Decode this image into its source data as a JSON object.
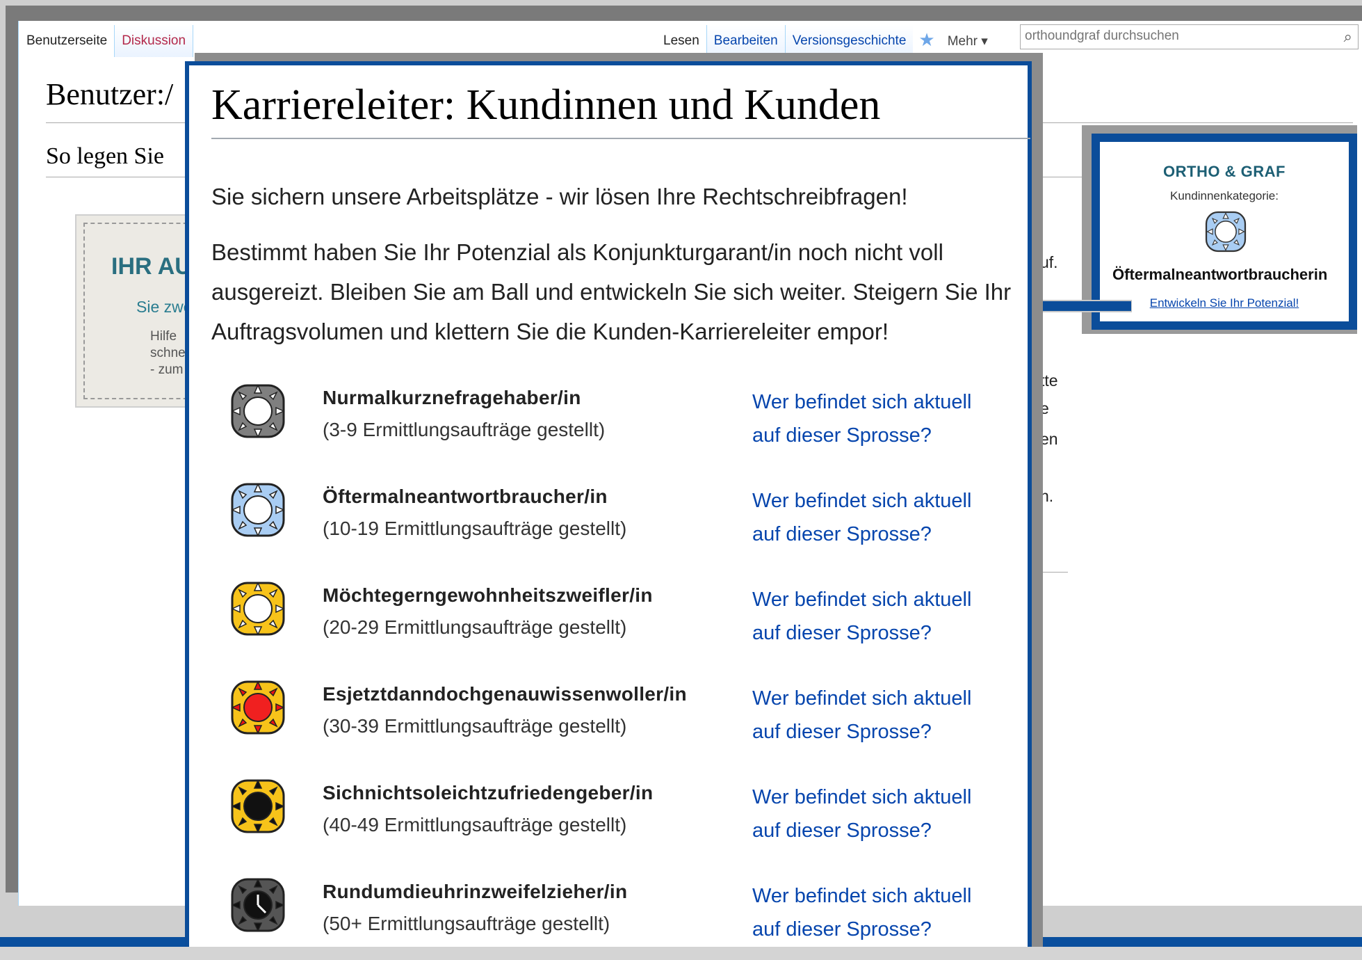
{
  "tabs": {
    "user_page": "Benutzerseite",
    "discussion": "Diskussion",
    "read": "Lesen",
    "edit": "Bearbeiten",
    "history": "Versionsgeschichte",
    "more": "Mehr",
    "search_placeholder": "orthoundgraf durchsuchen"
  },
  "background": {
    "title": "Benutzer:/",
    "heading": "So legen Sie",
    "banner_heading": "IHR AU",
    "banner_sub": "Sie zwe",
    "banner_text": [
      "Hilfe",
      "schne",
      "- zum"
    ],
    "fragments": [
      "uf.",
      "tte",
      "e",
      "en",
      "n."
    ]
  },
  "modal": {
    "title": "Karriereleiter: Kundinnen und Kunden",
    "intro": "Sie sichern unsere Arbeitsplätze - wir lösen Ihre Rechtschreibfragen!",
    "body": "Bestimmt haben Sie Ihr Potenzial als Konjunkturgarant/in noch nicht voll ausgereizt. Bleiben Sie am Ball und entwickeln Sie sich weiter. Steigern Sie Ihr Auftragsvolumen und klettern Sie die Kunden-Karriereleiter empor!",
    "rungs": [
      {
        "name": "Nurmalkurznefragehaber/in",
        "count": "(3-9 Ermittlungsaufträge gestellt)",
        "link1": "Wer befindet sich aktuell",
        "link2": "auf dieser Sprosse?"
      },
      {
        "name": "Öftermalneantwortbraucher/in",
        "count": "(10-19 Ermittlungsaufträge gestellt)",
        "link1": "Wer befindet sich aktuell",
        "link2": "auf dieser Sprosse?"
      },
      {
        "name": "Möchtegerngewohnheitszweifler/in",
        "count": "(20-29 Ermittlungsaufträge gestellt)",
        "link1": "Wer befindet sich aktuell",
        "link2": "auf dieser Sprosse?"
      },
      {
        "name": "Esjetztdanndochgenauwissenwoller/in",
        "count": "(30-39 Ermittlungsaufträge gestellt)",
        "link1": "Wer befindet sich aktuell",
        "link2": "auf dieser Sprosse?"
      },
      {
        "name": "Sichnichtsoleichtzufriedengeber/in",
        "count": "(40-49 Ermittlungsaufträge gestellt)",
        "link1": "Wer befindet sich aktuell",
        "link2": "auf dieser Sprosse?"
      },
      {
        "name": "Rundumdieuhrinzweifelzieher/in",
        "count": "(50+ Ermittlungsaufträge gestellt)",
        "link1": "Wer befindet sich aktuell",
        "link2": "auf dieser Sprosse?"
      }
    ]
  },
  "sidebox": {
    "brand": "ORTHO & GRAF",
    "category_label": "Kundinnenkategorie:",
    "category_value": "Öftermalneantwortbraucherin",
    "link": "Entwickeln Sie Ihr Potenzial!"
  },
  "icons": {
    "rung_icons": [
      "gray-sun-badge-icon",
      "light-blue-sun-badge-icon",
      "yellow-sun-badge-icon",
      "red-sun-badge-icon",
      "black-sun-badge-icon",
      "clock-badge-icon"
    ],
    "fill_colors": [
      "#7f7f7f",
      "#a9cdf3",
      "#f7c31a",
      "#f7c31a",
      "#f7c31a",
      "#555555"
    ],
    "center_colors": [
      "#ffffff",
      "#ffffff",
      "#ffffff",
      "#f02020",
      "#111111",
      "#111111"
    ],
    "arrow_color": "#0b4d9a",
    "accent": "#0b4d9a"
  }
}
